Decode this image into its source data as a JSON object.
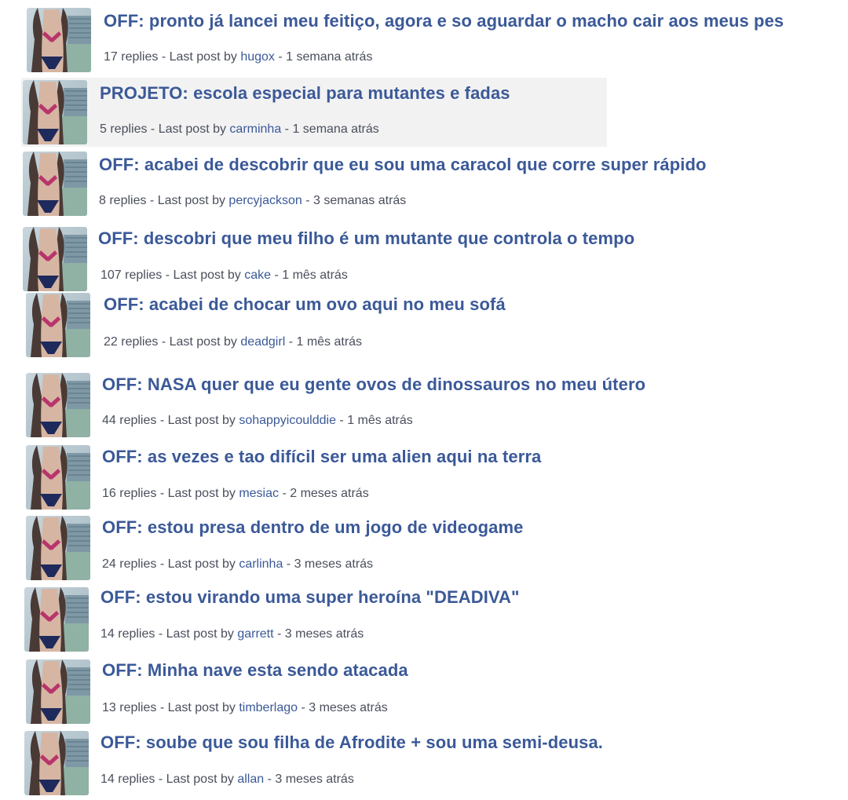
{
  "colors": {
    "title_link": "#3b5998",
    "meta_text": "#4a4f5c",
    "row_highlight": "#f2f2f2"
  },
  "meta": {
    "replies_suffix": " replies - Last post by ",
    "separator": " - "
  },
  "avatar_icon": "user-avatar-photo",
  "topics": [
    {
      "title": "OFF: pronto já lancei meu feitiço, agora e so aguardar o macho cair aos meus pes",
      "replies": "17",
      "last_user": "hugox",
      "time": "1 semana atrás"
    },
    {
      "title": "PROJETO: escola especial para mutantes e fadas",
      "replies": "5",
      "last_user": "carminha",
      "time": "1 semana atrás"
    },
    {
      "title": "OFF: acabei de descobrir que eu sou uma caracol que corre super rápido",
      "replies": "8",
      "last_user": "percyjackson",
      "time": "3 semanas atrás"
    },
    {
      "title": "OFF: descobri que meu filho é um mutante que controla o tempo",
      "replies": "107",
      "last_user": "cake",
      "time": "1 mês atrás"
    },
    {
      "title": "OFF: acabei de chocar um ovo aqui no meu sofá",
      "replies": "22",
      "last_user": "deadgirl",
      "time": "1 mês atrás"
    },
    {
      "title": "OFF: NASA quer que eu gente ovos de dinossauros no meu útero",
      "replies": "44",
      "last_user": "sohappyicoulddie",
      "time": "1 mês atrás"
    },
    {
      "title": "OFF: as vezes e tao difícil ser uma alien aqui na terra",
      "replies": "16",
      "last_user": "mesiac",
      "time": "2 meses atrás"
    },
    {
      "title": "OFF: estou presa dentro de um jogo de videogame",
      "replies": "24",
      "last_user": "carlinha",
      "time": "3 meses atrás"
    },
    {
      "title": "OFF: estou virando uma super heroína \"DEADIVA\"",
      "replies": "14",
      "last_user": "garrett",
      "time": "3 meses atrás"
    },
    {
      "title": "OFF: Minha nave esta sendo atacada",
      "replies": "13",
      "last_user": "timberlago",
      "time": "3 meses atrás"
    },
    {
      "title": "OFF: soube que sou filha de Afrodite + sou uma semi-deusa.",
      "replies": "14",
      "last_user": "allan",
      "time": "3 meses atrás"
    }
  ]
}
